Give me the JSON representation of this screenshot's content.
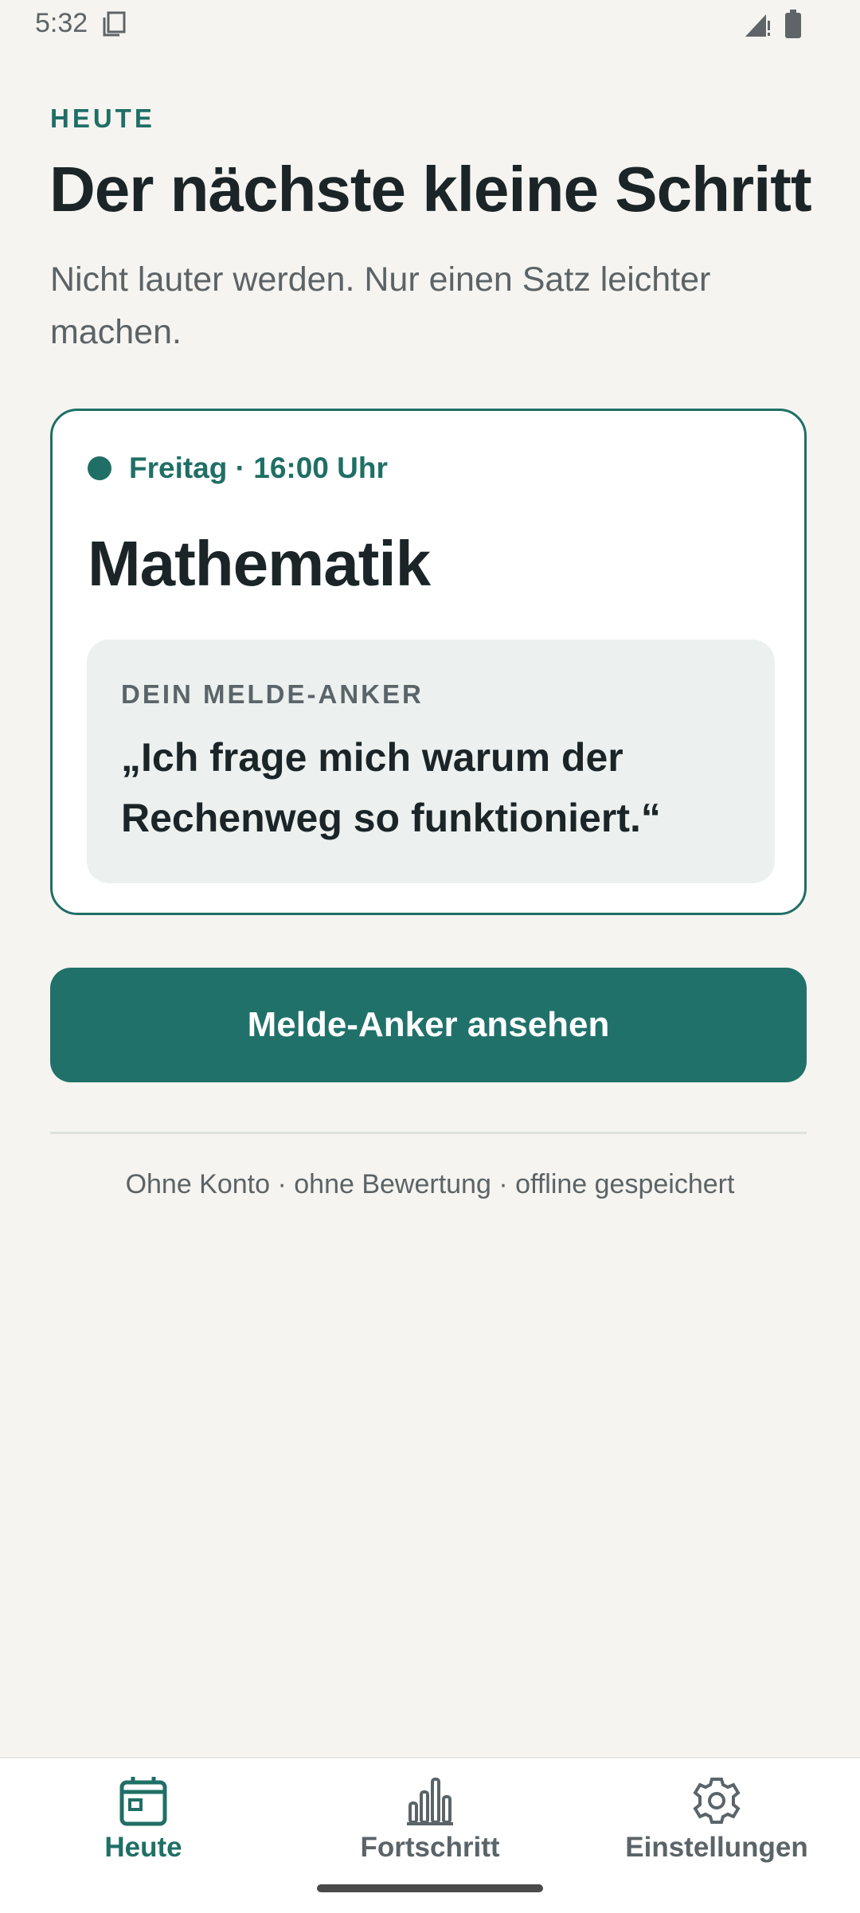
{
  "status_bar": {
    "time": "5:32",
    "icons": [
      "sim-card-icon",
      "signal-icon",
      "battery-icon"
    ]
  },
  "header": {
    "eyebrow": "HEUTE",
    "title": "Der nächste kleine Schritt",
    "subtitle": "Nicht lauter werden. Nur einen Satz leichter machen."
  },
  "card": {
    "meta": "Freitag · 16:00 Uhr",
    "subject": "Mathematik",
    "anchor_label": "DEIN MELDE-ANKER",
    "anchor_quote": "„Ich frage mich warum der Rechenweg so funktioniert.“"
  },
  "primary_button": {
    "label": "Melde-Anker ansehen"
  },
  "footer_note": "Ohne Konto · ohne Bewertung · offline gespeichert",
  "bottom_nav": {
    "items": [
      {
        "label": "Heute",
        "icon": "calendar-icon",
        "active": true
      },
      {
        "label": "Fortschritt",
        "icon": "bar-chart-icon",
        "active": false
      },
      {
        "label": "Einstellungen",
        "icon": "gear-icon",
        "active": false
      }
    ]
  },
  "colors": {
    "accent": "#1F6F66",
    "background": "#F5F4F0",
    "text": "#1B2528",
    "muted": "#5C6366"
  }
}
